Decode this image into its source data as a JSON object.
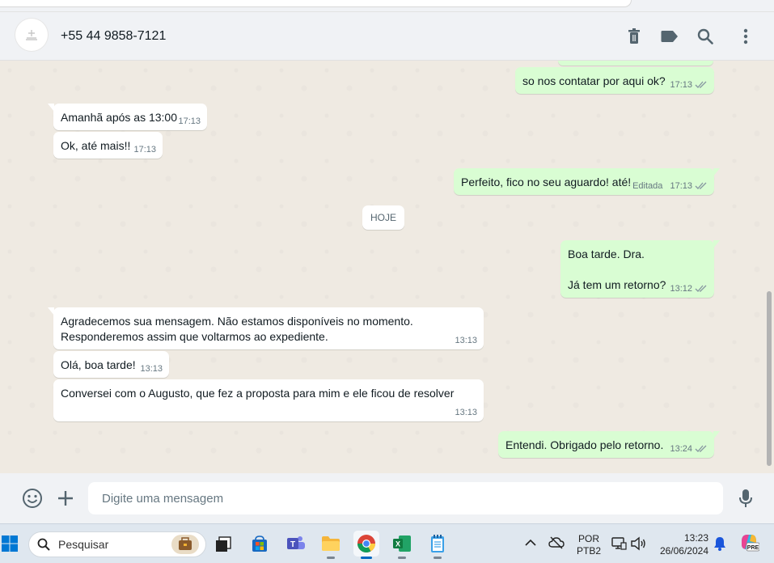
{
  "header": {
    "contact_name": "+55 44 9858-7121",
    "icons": [
      "trash-icon",
      "label-icon",
      "search-icon",
      "menu-icon"
    ]
  },
  "messages": [
    {
      "direction": "out",
      "text": "so nos contatar por aqui ok?",
      "time": "17:13",
      "status": "read"
    },
    {
      "direction": "in",
      "text": "Amanhã após as 13:00",
      "time": "17:13"
    },
    {
      "direction": "in",
      "text": "Ok, até mais!!",
      "time": "17:13"
    },
    {
      "direction": "out",
      "text": "Perfeito, fico no seu aguardo! até!",
      "edited": "Editada",
      "time": "17:13",
      "status": "read"
    },
    {
      "direction": "out",
      "text_line1": "Boa tarde. Dra.",
      "text_line2": "Já tem um retorno?",
      "time": "13:12",
      "status": "read"
    },
    {
      "direction": "in",
      "text_line1": "Agradecemos sua mensagem. Não estamos disponíveis no momento.",
      "text_line2": "Responderemos assim que voltarmos ao expediente.",
      "time": "13:13"
    },
    {
      "direction": "in",
      "text": "Olá, boa tarde!",
      "time": "13:13"
    },
    {
      "direction": "in",
      "text": "Conversei com o Augusto, que fez a proposta para mim e ele ficou de resolver",
      "time": "13:13"
    },
    {
      "direction": "out",
      "text": "Entendi. Obrigado pelo retorno.",
      "time": "13:24",
      "status": "read"
    }
  ],
  "date_divider": "HOJE",
  "composer": {
    "placeholder": "Digite uma mensagem"
  },
  "taskbar": {
    "search_label": "Pesquisar",
    "language_line1": "POR",
    "language_line2": "PTB2",
    "clock_time": "13:23",
    "clock_date": "26/06/2024",
    "copilot_badge": "PRE"
  },
  "colors": {
    "outgoing_bubble": "#d9fdd3",
    "incoming_bubble": "#ffffff",
    "chat_background": "#efeae2",
    "read_ticks": "#53bdeb",
    "panel": "#f0f2f5"
  }
}
